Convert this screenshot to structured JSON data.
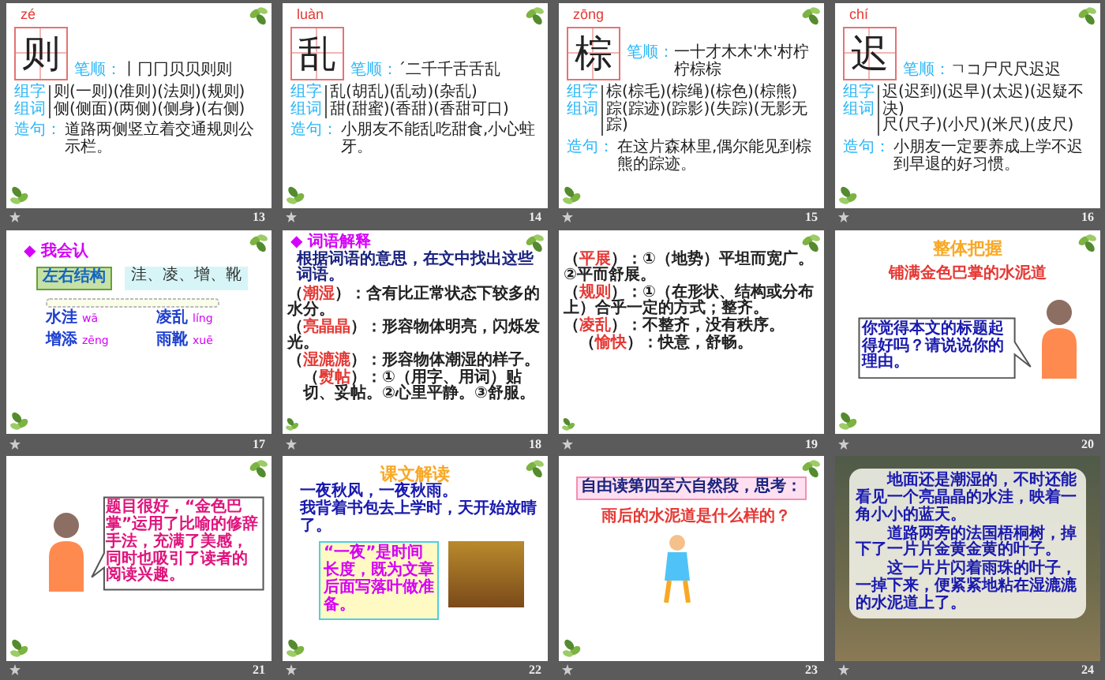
{
  "slides": [
    {
      "number": "13",
      "kind": "character",
      "pinyin": "zé",
      "character": "则",
      "stroke_label": "笔顺：",
      "strokes": "丨冂冂贝贝则则",
      "word_labels": [
        "组字",
        "组词"
      ],
      "word_lines": [
        "则(一则)(准则)(法则)(规则)",
        "侧(侧面)(两侧)(侧身)(右侧)"
      ],
      "sentence_label": "造句：",
      "sentence": "道路两侧竖立着交通规则公示栏。"
    },
    {
      "number": "14",
      "kind": "character",
      "pinyin": "luàn",
      "character": "乱",
      "stroke_label": "笔顺：",
      "strokes": "ˊ二千千舌舌乱",
      "word_labels": [
        "组字",
        "组词"
      ],
      "word_lines": [
        "乱(胡乱)(乱动)(杂乱)",
        "甜(甜蜜)(香甜)(香甜可口)"
      ],
      "sentence_label": "造句：",
      "sentence": "小朋友不能乱吃甜食,小心蛀牙。"
    },
    {
      "number": "15",
      "kind": "character",
      "pinyin": "zōng",
      "character": "棕",
      "stroke_label": "笔顺：",
      "strokes": "一十才木木'木'村柠柠棕棕",
      "word_labels": [
        "组字",
        "组词"
      ],
      "word_lines": [
        "棕(棕毛)(棕绳)(棕色)(棕熊)",
        "踪(踪迹)(踪影)(失踪)(无影无踪)"
      ],
      "sentence_label": "造句：",
      "sentence": "在这片森林里,偶尔能见到棕熊的踪迹。"
    },
    {
      "number": "16",
      "kind": "character",
      "pinyin": "chí",
      "character": "迟",
      "stroke_label": "笔顺：",
      "strokes": "ㄱコ尸尺尺迟迟",
      "word_labels": [
        "组字",
        "组词"
      ],
      "word_lines": [
        "迟(迟到)(迟早)(太迟)(迟疑不决)",
        "尺(尺子)(小尺)(米尺)(皮尺)"
      ],
      "sentence_label": "造句：",
      "sentence": "小朋友一定要养成上学不迟到早退的好习惯。"
    },
    {
      "number": "17",
      "kind": "recognize",
      "heading": "◆ 我会认",
      "structure": "左右结构",
      "characters": "洼、凌、增、靴",
      "words": [
        {
          "word": "水洼",
          "pinyin": "wā"
        },
        {
          "word": "凌乱",
          "pinyin": "líng"
        },
        {
          "word": "增添",
          "pinyin": "zēng"
        },
        {
          "word": "雨靴",
          "pinyin": "xuē"
        }
      ]
    },
    {
      "number": "18",
      "kind": "glossary",
      "heading": "◆ 词语解释",
      "instruction": "根据词语的意思，在文中找出这些词语。",
      "entries": [
        {
          "open": "（",
          "term": "潮湿",
          "close": "）",
          "definition": "：含有比正常状态下较多的水分。"
        },
        {
          "open": "（",
          "term": "亮晶晶",
          "close": "）",
          "definition": "：形容物体明亮，闪烁发光。"
        },
        {
          "open": "（",
          "term": "湿漉漉",
          "close": "）",
          "definition": "：形容物体潮湿的样子。"
        },
        {
          "open": "（",
          "term": "熨帖",
          "close": "）",
          "definition": "：①（用字、用词）贴切、妥帖。②心里平静。③舒服。"
        }
      ]
    },
    {
      "number": "19",
      "kind": "glossary",
      "entries": [
        {
          "open": "（",
          "term": "平展",
          "close": "）",
          "definition": "：①（地势）平坦而宽广。②平而舒展。"
        },
        {
          "open": "（",
          "term": "规则",
          "close": "）",
          "definition": "：①（在形状、结构或分布上）合乎一定的方式；整齐。"
        },
        {
          "open": "（",
          "term": "凌乱",
          "close": "）",
          "definition": "：不整齐，没有秩序。"
        },
        {
          "open": "（",
          "term": "愉快",
          "close": "）",
          "definition": "：快意，舒畅。"
        }
      ]
    },
    {
      "number": "20",
      "kind": "overview",
      "title": "整体把握",
      "subtitle": "铺满金色巴掌的水泥道",
      "bubble": "你觉得本文的标题起得好吗？请说说你的理由。"
    },
    {
      "number": "21",
      "kind": "speech",
      "bubble": "题目很好，“金色巴掌”运用了比喻的修辞手法，充满了美感，同时也吸引了读者的阅读兴趣。"
    },
    {
      "number": "22",
      "kind": "reading",
      "title": "课文解读",
      "lines": [
        "一夜秋风，一夜秋雨。",
        "我背着书包去上学时，天开始放晴了。"
      ],
      "note": "“一夜”是时间长度，既为文章后面写落叶做准备。"
    },
    {
      "number": "23",
      "kind": "question",
      "prompt": "自由读第四至六自然段，思考：",
      "question": "雨后的水泥道是什么样的？"
    },
    {
      "number": "24",
      "kind": "passage",
      "paragraphs": [
        "地面还是潮湿的，不时还能看见一个亮晶晶的水洼，映着一角小小的蓝天。",
        "道路两旁的法国梧桐树，掉下了一片片金黄金黄的叶子。",
        "这一片片闪着雨珠的叶子，一掉下来，便紧紧地粘在湿漉漉的水泥道上了。"
      ]
    }
  ]
}
